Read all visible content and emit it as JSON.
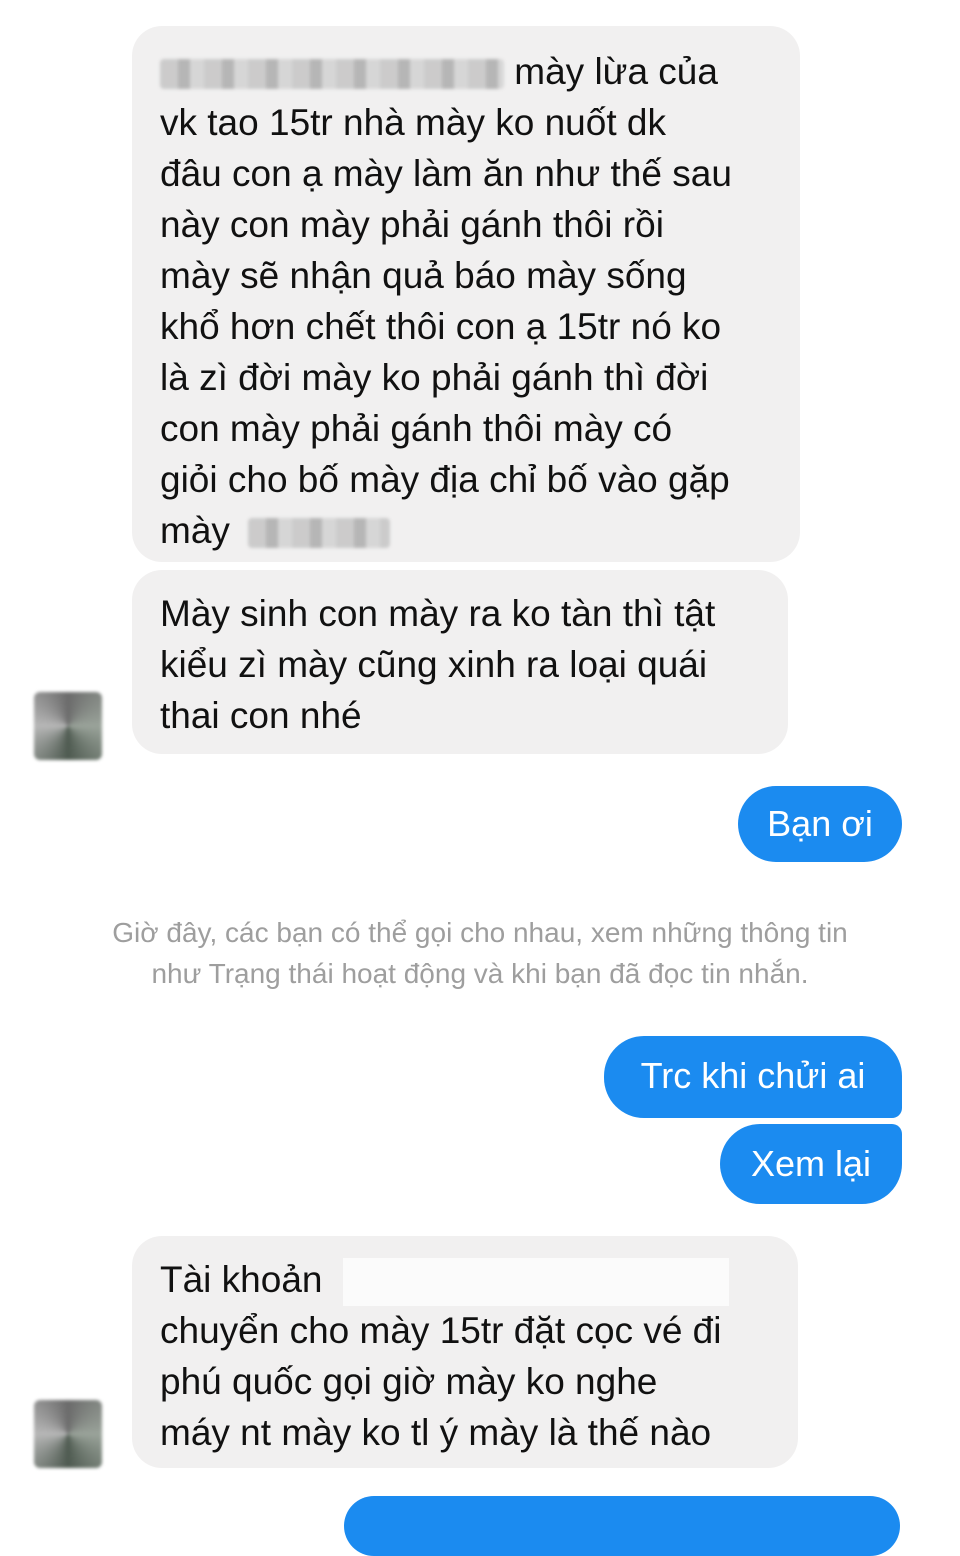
{
  "messages": {
    "m1": {
      "lines": [
        "mày lừa của",
        "vk tao 15tr nhà mày ko nuốt dk",
        "đâu con ạ mày làm ăn như thế sau",
        "này con mày phải gánh thôi rồi",
        "mày sẽ nhận quả báo mày sống",
        "khổ hơn chết thôi con ạ 15tr nó ko",
        "là zì đời mày ko phải gánh thì đời",
        "con mày phải gánh thôi mày có",
        "giỏi cho bố mày địa chỉ bố vào gặp",
        "mày"
      ]
    },
    "m2": {
      "lines": [
        "Mày sinh con mày ra ko tàn thì tật",
        "kiểu zì mày cũng xinh ra loại quái",
        "thai  con nhé"
      ]
    },
    "sent1": "Bạn ơi",
    "notice": [
      "Giờ đây, các bạn có thể gọi cho nhau, xem những thông tin",
      "như Trạng thái hoạt động và khi bạn đã đọc tin nhắn."
    ],
    "sent2": "Trc khi chửi ai",
    "sent3": "Xem lại",
    "m3": {
      "lines": [
        "Tài khoản",
        "chuyển cho mày 15tr đặt cọc vé đi",
        "phú quốc gọi giờ mày ko nghe",
        "máy nt mày ko tl ý mày là thế nào"
      ]
    }
  },
  "colors": {
    "incoming_bubble": "#f1f0f0",
    "outgoing_bubble": "#1b8bf0",
    "notice_text": "#9e9e9e"
  }
}
